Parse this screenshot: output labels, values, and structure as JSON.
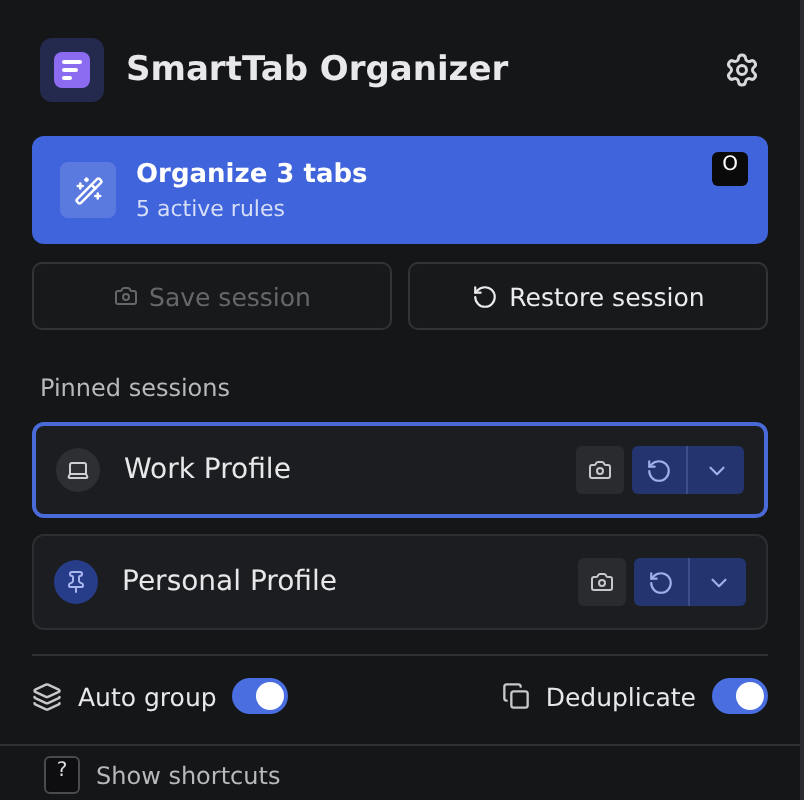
{
  "header": {
    "title": "SmartTab Organizer"
  },
  "organize": {
    "title": "Organize 3 tabs",
    "subtitle": "5 active rules",
    "shortcut": "O"
  },
  "actions": [
    {
      "label": "Save session",
      "kind": "save",
      "disabled": true
    },
    {
      "label": "Restore session",
      "kind": "restore",
      "disabled": false
    }
  ],
  "pinned": {
    "heading": "Pinned sessions",
    "sessions": [
      {
        "name": "Work Profile",
        "kind": "laptop",
        "selected": true
      },
      {
        "name": "Personal Profile",
        "kind": "pin",
        "selected": false
      }
    ]
  },
  "toggles": [
    {
      "label": "Auto group",
      "kind": "group",
      "on": true
    },
    {
      "label": "Deduplicate",
      "kind": "dedupe",
      "on": true
    }
  ],
  "footer": {
    "key": "?",
    "label": "Show shortcuts"
  }
}
